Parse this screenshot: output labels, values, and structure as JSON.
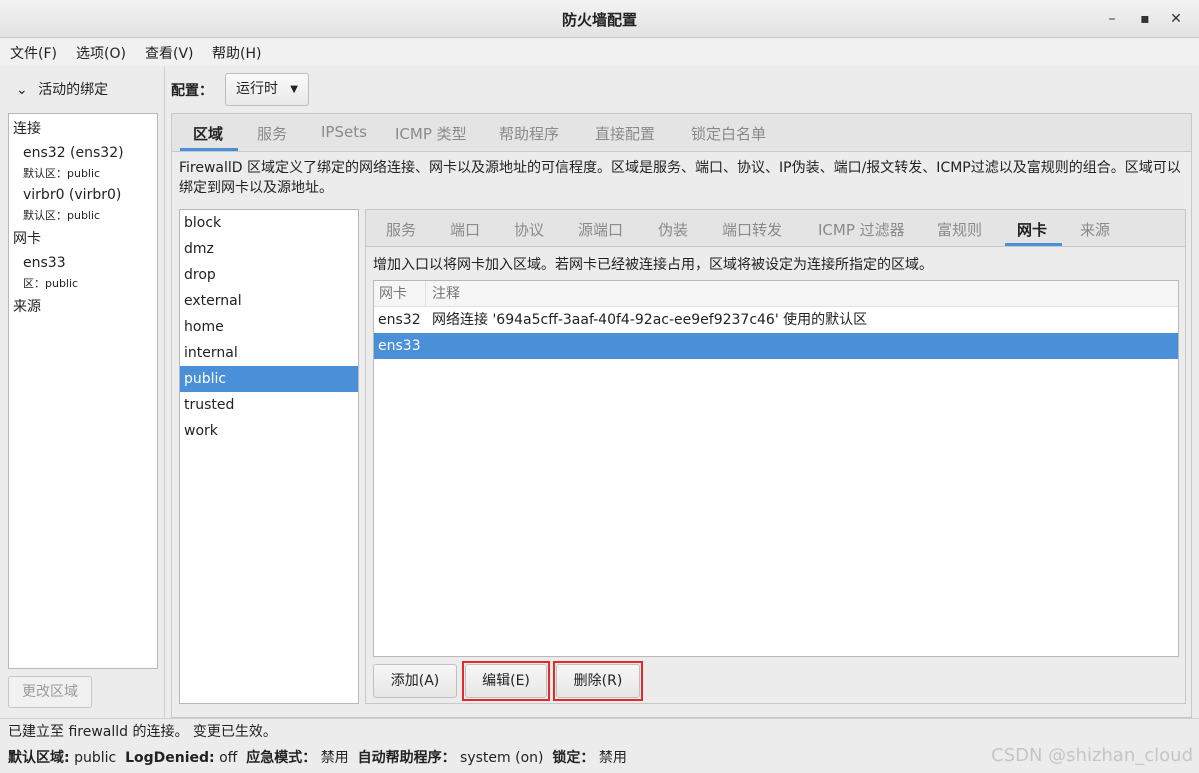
{
  "window": {
    "title": "防火墙配置"
  },
  "menu": [
    "文件(F)",
    "选项(O)",
    "查看(V)",
    "帮助(H)"
  ],
  "bindings": {
    "header": "活动的绑定",
    "connections_label": "连接",
    "connections": [
      {
        "name": "ens32 (ens32)",
        "zone": "默认区：public"
      },
      {
        "name": "virbr0 (virbr0)",
        "zone": "默认区：public"
      }
    ],
    "interfaces_label": "网卡",
    "interfaces": [
      {
        "name": "ens33",
        "zone": "区：public"
      }
    ],
    "sources_label": "来源",
    "change_zone_button": "更改区域"
  },
  "config": {
    "label": "配置：",
    "value": "运行时"
  },
  "top_tabs": [
    "区域",
    "服务",
    "IPSets",
    "ICMP 类型",
    "帮助程序",
    "直接配置",
    "锁定白名单"
  ],
  "zone_description": "FirewallD 区域定义了绑定的网络连接、网卡以及源地址的可信程度。区域是服务、端口、协议、IP伪装、端口/报文转发、ICMP过滤以及富规则的组合。区域可以绑定到网卡以及源地址。",
  "zones": [
    "block",
    "dmz",
    "drop",
    "external",
    "home",
    "internal",
    "public",
    "trusted",
    "work"
  ],
  "selected_zone": "public",
  "sub_tabs": [
    "服务",
    "端口",
    "协议",
    "源端口",
    "伪装",
    "端口转发",
    "ICMP 过滤器",
    "富规则",
    "网卡",
    "来源"
  ],
  "interfaces_panel": {
    "description": "增加入口以将网卡加入区域。若网卡已经被连接占用，区域将被设定为连接所指定的区域。",
    "columns": [
      "网卡",
      "注释"
    ],
    "rows": [
      {
        "iface": "ens32",
        "comment": "网络连接 '694a5cff-3aaf-40f4-92ac-ee9ef9237c46' 使用的默认区"
      },
      {
        "iface": "ens33",
        "comment": ""
      }
    ],
    "buttons": {
      "add": "添加(A)",
      "edit": "编辑(E)",
      "remove": "删除(R)"
    }
  },
  "status": {
    "line1": "已建立至  firewalld 的连接。 变更已生效。",
    "default_zone_label": "默认区域:",
    "default_zone": "public",
    "log_denied_label": "LogDenied:",
    "log_denied": "off",
    "panic_label": "应急模式：",
    "panic": "禁用",
    "auto_helper_label": "自动帮助程序：",
    "auto_helper": "system (on)",
    "lockdown_label": "锁定：",
    "lockdown": "禁用"
  },
  "watermark": "CSDN @shizhan_cloud",
  "colors": {
    "selection": "#4a90d9",
    "highlight_box": "#e22a2a"
  }
}
